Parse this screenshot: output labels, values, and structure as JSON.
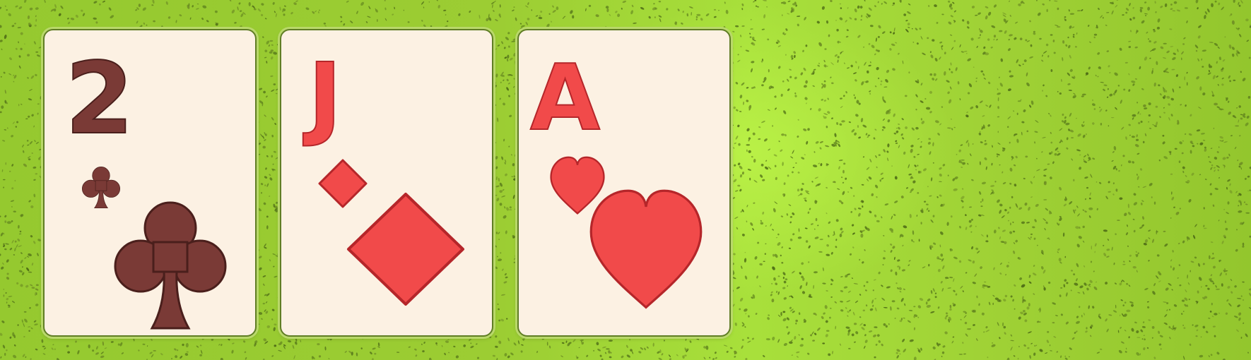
{
  "table": {
    "felt_color": "#9fd135"
  },
  "hand": [
    {
      "rank": "2",
      "suit": "clubs",
      "suit_icon": "club-icon",
      "color": "#7a3a36"
    },
    {
      "rank": "J",
      "suit": "diamonds",
      "suit_icon": "diamond-icon",
      "color": "#f14a4a"
    },
    {
      "rank": "A",
      "suit": "hearts",
      "suit_icon": "heart-icon",
      "color": "#f14a4a"
    }
  ]
}
